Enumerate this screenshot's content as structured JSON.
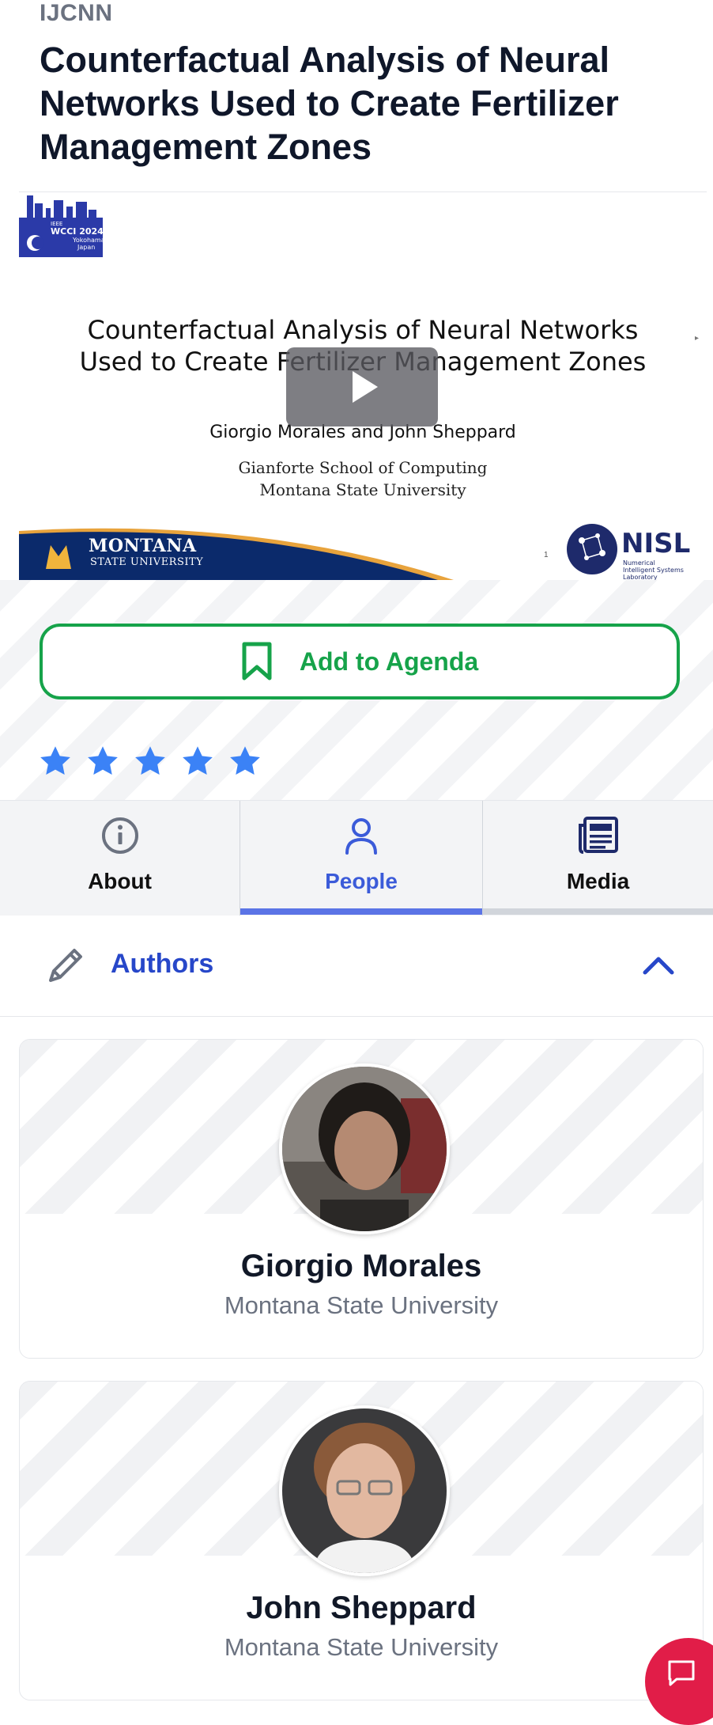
{
  "event": {
    "track": "IJCNN",
    "title": "Counterfactual Analysis of Neural Networks Used to Create Fertilizer Management Zones"
  },
  "video": {
    "logo_lines": [
      "IEEE",
      "WCCI 2024",
      "Yokohama",
      "Japan"
    ],
    "slide_title_line1": "Counterfactual Analysis of Neural Networks",
    "slide_title_line2": "Used to Create Fertilizer Management Zones",
    "slide_authors": "Giorgio Morales and John Sheppard",
    "slide_affil_line1": "Gianforte School of Computing",
    "slide_affil_line2": "Montana State University",
    "montana_name": "MONTANA",
    "montana_sub": "STATE UNIVERSITY",
    "nisl_name": "NISL",
    "nisl_sub": "Numerical Intelligent Systems Laboratory",
    "slide_number": "1",
    "play_icon": "play-icon"
  },
  "actions": {
    "add_to_agenda": "Add to Agenda",
    "bookmark_icon": "bookmark-icon"
  },
  "rating": {
    "stars": 5,
    "max": 5,
    "color": "#3b82f6"
  },
  "tabs": [
    {
      "label": "About",
      "icon": "info-icon"
    },
    {
      "label": "People",
      "icon": "person-icon",
      "active": true
    },
    {
      "label": "Media",
      "icon": "newspaper-icon"
    }
  ],
  "authors_section": {
    "title": "Authors",
    "icon": "pencil-icon",
    "toggle_icon": "chevron-up-icon"
  },
  "authors": [
    {
      "name": "Giorgio Morales",
      "affiliation": "Montana State University"
    },
    {
      "name": "John Sheppard",
      "affiliation": "Montana State University"
    }
  ],
  "colors": {
    "accent_green": "#16a34a",
    "accent_blue": "#2747c9",
    "chat_red": "#e11d48"
  },
  "chat": {
    "icon": "chat-icon"
  }
}
